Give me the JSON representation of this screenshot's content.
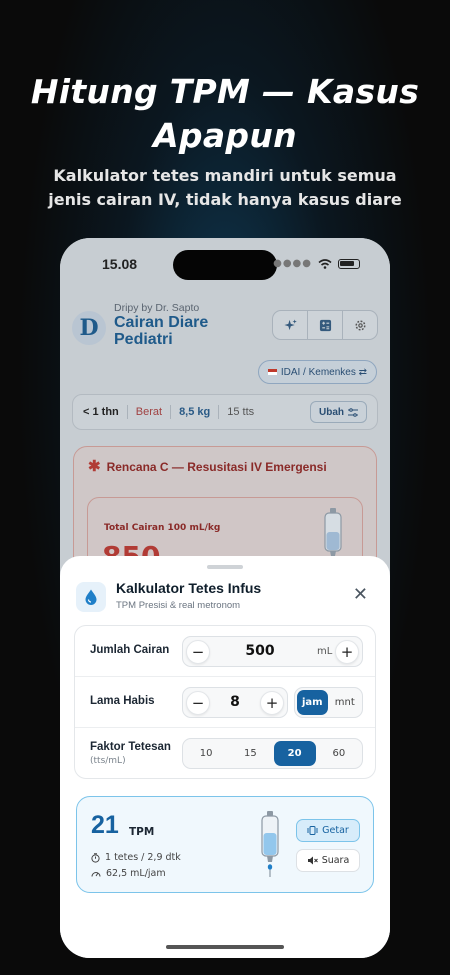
{
  "promo": {
    "title": "Hitung TPM — Kasus Apapun",
    "subtitle": "Kalkulator tetes mandiri untuk semua jenis cairan IV, tidak hanya kasus diare"
  },
  "status_bar": {
    "time": "15.08"
  },
  "app": {
    "logo_letter": "D",
    "byline": "Dripy by Dr. Sapto",
    "title": "Cairan Diare Pediatri",
    "toolbar_icons": [
      "sparkles-icon",
      "calculator-icon",
      "gear-icon"
    ],
    "guideline_chip": "IDAI / Kemenkes ⇄"
  },
  "patient": {
    "age": "< 1 thn",
    "weight_label": "Berat",
    "weight": "8,5 kg",
    "drops": "15 tts",
    "change_button": "Ubah"
  },
  "plan": {
    "title": "Rencana C — Resusitasi IV Emergensi",
    "total_label": "Total Cairan 100 mL/kg",
    "total_value": "850"
  },
  "sheet": {
    "title": "Kalkulator Tetes Infus",
    "subtitle": "TPM Presisi & real metronom",
    "fields": {
      "volume": {
        "label": "Jumlah Cairan",
        "value": "500",
        "unit": "mL"
      },
      "duration": {
        "label": "Lama Habis",
        "value": "8",
        "units": [
          "jam",
          "mnt"
        ],
        "selected_unit": "jam"
      },
      "drop_factor": {
        "label": "Faktor Tetesan",
        "sublabel": "(tts/mL)",
        "options": [
          "10",
          "15",
          "20",
          "60"
        ],
        "selected": "20"
      }
    },
    "result": {
      "value": "21",
      "unit": "TPM",
      "per_drop": "1 tetes / 2,9 dtk",
      "rate": "62,5 mL/jam",
      "vibrate_button": "Getar",
      "sound_button": "Suara"
    }
  },
  "colors": {
    "accent": "#1762a0",
    "emergency": "#b13b35",
    "result_border": "#7cc4ea"
  }
}
